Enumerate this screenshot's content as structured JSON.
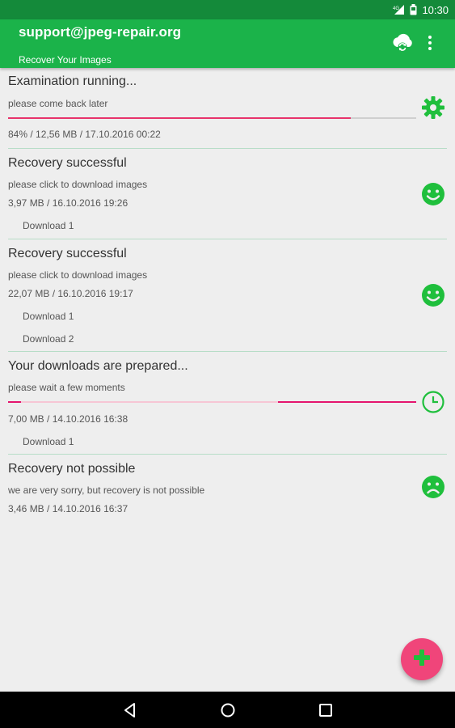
{
  "status_bar": {
    "time": "10:30",
    "network_label": "4G"
  },
  "app_bar": {
    "title": "support@jpeg-repair.org",
    "subtitle": "Recover Your Images",
    "actions": [
      "cloud-sync-icon",
      "overflow-menu-icon"
    ]
  },
  "jobs": [
    {
      "title": "Examination running...",
      "subtitle": "please come back later",
      "meta": "84% / 12,56 MB / 17.10.2016 00:22",
      "progress": 0.84,
      "icon": "gear-icon",
      "downloads": []
    },
    {
      "title": "Recovery successful",
      "subtitle": "please click to download images",
      "meta": "3,97 MB / 16.10.2016 19:26",
      "icon": "smiley-happy-icon",
      "downloads": [
        "Download 1"
      ]
    },
    {
      "title": "Recovery successful",
      "subtitle": "please click to download images",
      "meta": "22,07 MB / 16.10.2016 19:17",
      "icon": "smiley-happy-icon",
      "downloads": [
        "Download 1",
        "Download 2"
      ]
    },
    {
      "title": "Your downloads are prepared...",
      "subtitle": "please wait a few moments",
      "meta": "7,00 MB / 14.10.2016 16:38",
      "icon": "clock-icon",
      "progress_indeterminate": true,
      "downloads": [
        "Download 1"
      ]
    },
    {
      "title": "Recovery not possible",
      "subtitle": "we are very sorry, but recovery is not possible",
      "meta": "3,46 MB / 14.10.2016 16:37",
      "icon": "smiley-sad-icon",
      "downloads": []
    }
  ],
  "fab": {
    "icon": "plus-icon"
  },
  "nav_bar": [
    "back-icon",
    "home-icon",
    "recents-icon"
  ],
  "colors": {
    "primary": "#1bb34a",
    "primary_dark": "#148a3a",
    "accent": "#f0457a",
    "progress": "#e8336b",
    "icon_green": "#1fbf3c",
    "divider": "#b7ddc7"
  }
}
